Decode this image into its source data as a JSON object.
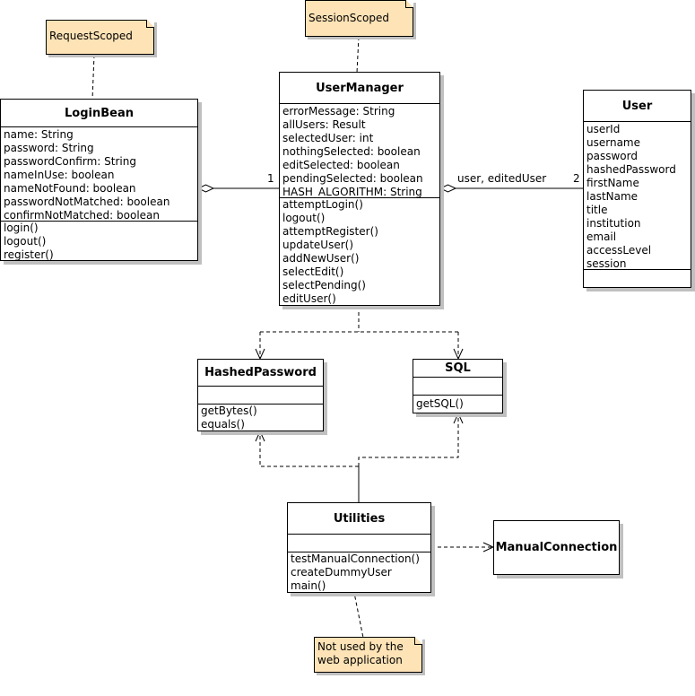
{
  "notes": {
    "request_scoped": "RequestScoped",
    "session_scoped": "SessionScoped",
    "not_used_line1": "Not used by the",
    "not_used_line2": "web application"
  },
  "classes": {
    "login_bean": {
      "name": "LoginBean",
      "attributes": [
        "name: String",
        "password: String",
        "passwordConfirm: String",
        "nameInUse: boolean",
        "nameNotFound: boolean",
        "passwordNotMatched: boolean",
        "confirmNotMatched: boolean"
      ],
      "methods": [
        "login()",
        "logout()",
        "register()"
      ]
    },
    "user_manager": {
      "name": "UserManager",
      "attributes": [
        "errorMessage: String",
        "allUsers: Result",
        "selectedUser: int",
        "nothingSelected: boolean",
        "editSelected: boolean",
        "pendingSelected: boolean",
        "HASH_ALGORITHM: String"
      ],
      "methods": [
        "attemptLogin()",
        "logout()",
        "attemptRegister()",
        "updateUser()",
        "addNewUser()",
        "selectEdit()",
        "selectPending()",
        "editUser()"
      ]
    },
    "user": {
      "name": "User",
      "attributes": [
        "userId",
        "username",
        "password",
        "hashedPassword",
        "firstName",
        "lastName",
        "title",
        "institution",
        "email",
        "accessLevel",
        "session"
      ],
      "methods": []
    },
    "hashed_password": {
      "name": "HashedPassword",
      "attributes": [],
      "methods": [
        "getBytes()",
        "equals()"
      ]
    },
    "sql": {
      "name": "SQL",
      "attributes": [],
      "methods": [
        "getSQL()"
      ]
    },
    "utilities": {
      "name": "Utilities",
      "attributes": [],
      "methods": [
        "testManualConnection()",
        "createDummyUser",
        "main()"
      ]
    },
    "manual_connection": {
      "name": "ManualConnection"
    }
  },
  "associations": {
    "loginbean_usermanager_multiplicity": "1",
    "usermanager_user_role": "user, editedUser",
    "usermanager_user_multiplicity": "2"
  }
}
